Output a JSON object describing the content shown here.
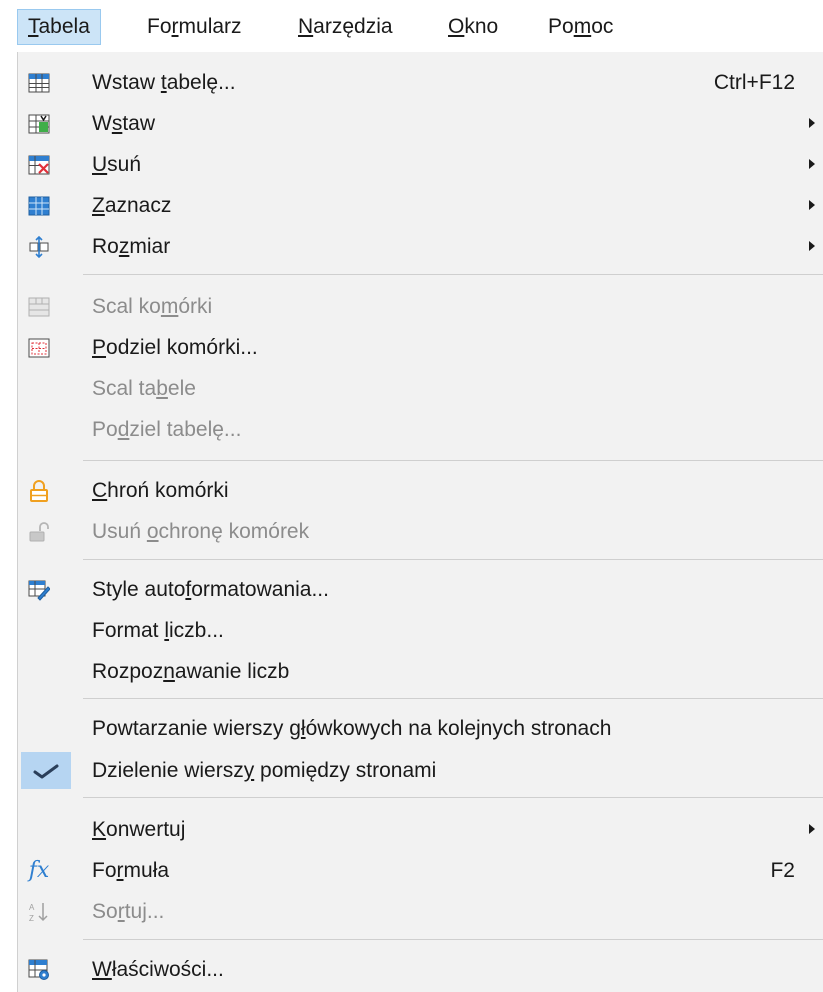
{
  "menubar": {
    "items": [
      {
        "label": "Tabela",
        "ul": 0
      },
      {
        "label": "Formularz",
        "ul": 2
      },
      {
        "label": "Narzędzia",
        "ul": 0
      },
      {
        "label": "Okno",
        "ul": 0
      },
      {
        "label": "Pomoc",
        "ul": 2
      }
    ]
  },
  "menu": {
    "items": [
      {
        "label": "Wstaw tabelę...",
        "ul": 6,
        "shortcut": "Ctrl+F12",
        "icon": "insert-table-icon"
      },
      {
        "label": "Wstaw",
        "ul": 1,
        "submenu": true,
        "icon": "insert-rows-icon"
      },
      {
        "label": "Usuń",
        "ul": 0,
        "submenu": true,
        "icon": "delete-table-icon"
      },
      {
        "label": "Zaznacz",
        "ul": 0,
        "submenu": true,
        "icon": "select-table-icon"
      },
      {
        "label": "Rozmiar",
        "ul": 2,
        "submenu": true,
        "icon": "resize-icon"
      },
      {
        "label": "Scal komórki",
        "ul": 7,
        "disabled": true,
        "icon": "merge-cells-icon"
      },
      {
        "label": "Podziel komórki...",
        "ul": 0,
        "icon": "split-cells-icon"
      },
      {
        "label": "Scal tabele",
        "ul": 7,
        "disabled": true
      },
      {
        "label": "Podziel tabelę...",
        "ul": 2,
        "disabled": true
      },
      {
        "label": "Chroń komórki",
        "ul": 0,
        "icon": "lock-icon"
      },
      {
        "label": "Usuń ochronę komórek",
        "ul": 5,
        "disabled": true,
        "icon": "unlock-icon"
      },
      {
        "label": "Style autoformatowania...",
        "ul": 10,
        "icon": "autoformat-icon"
      },
      {
        "label": "Format liczb...",
        "ul": 7
      },
      {
        "label": "Rozpoznawanie liczb",
        "ul": 6
      },
      {
        "label": "Powtarzanie wierszy główkowych na kolejnych stronach",
        "ul": 21
      },
      {
        "label": "Dzielenie wierszy pomiędzy stronami",
        "ul": 16,
        "checked": true,
        "icon": "checkmark-icon"
      },
      {
        "label": "Konwertuj",
        "ul": 0,
        "submenu": true
      },
      {
        "label": "Formuła",
        "ul": 2,
        "shortcut": "F2",
        "icon": "formula-icon",
        "icon_text": "fx"
      },
      {
        "label": "Sortuj...",
        "ul": 2,
        "disabled": true,
        "icon": "sort-icon"
      },
      {
        "label": "Właściwości...",
        "ul": 0,
        "icon": "table-properties-icon"
      }
    ]
  },
  "colors": {
    "menu_bg": "#f2f2f2",
    "active_bg": "#cce4f7",
    "checked_bg": "#b6d5f2",
    "disabled_text": "#8c8c8c",
    "icon_blue": "#2f7fd0",
    "icon_red": "#e0303a",
    "icon_orange": "#f0a020"
  }
}
